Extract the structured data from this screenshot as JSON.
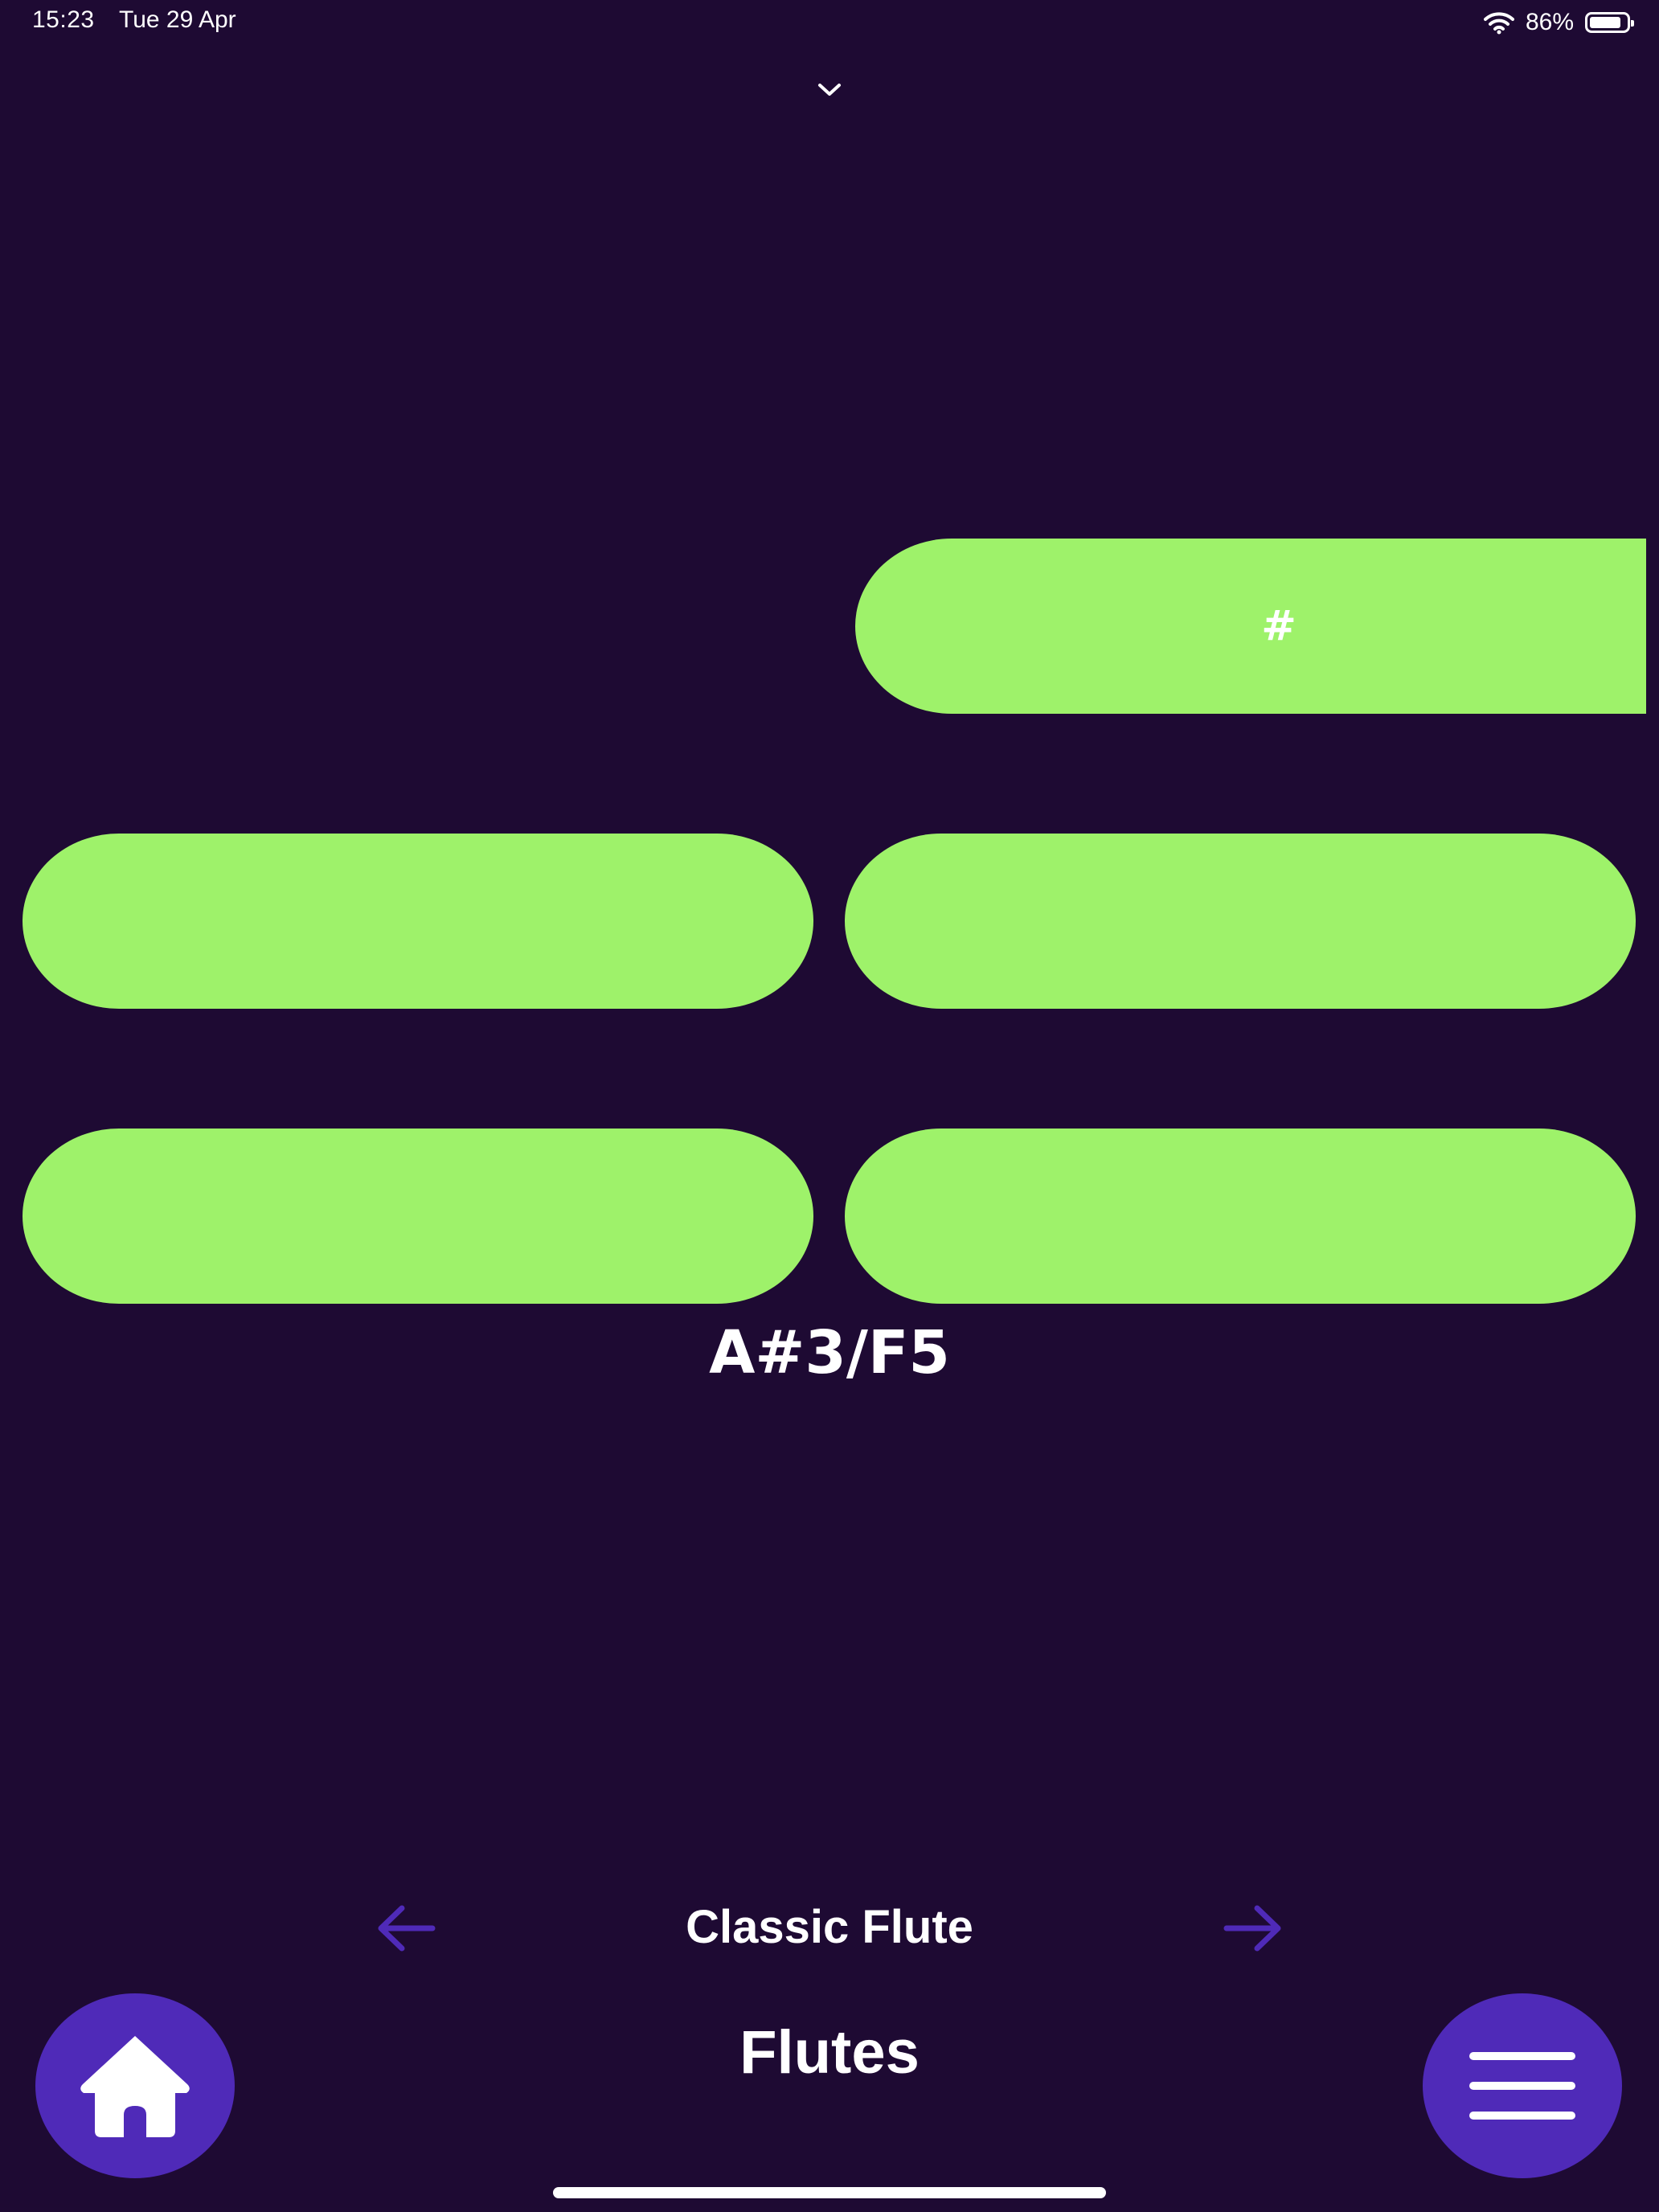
{
  "status_bar": {
    "time": "15:23",
    "date": "Tue 29 Apr",
    "battery_text": "86%",
    "battery_level": 0.86
  },
  "keys": {
    "sharp_label": "#",
    "key_color": "#9ef26a"
  },
  "note": "A#3/F5",
  "selector": {
    "instrument": "Classic Flute",
    "category": "Flutes"
  },
  "colors": {
    "background": "#1e0a33",
    "accent": "#4f2ab8",
    "key": "#9ef26a"
  },
  "icons": {
    "collapse": "chevron-down-icon",
    "prev": "arrow-left-icon",
    "next": "arrow-right-icon",
    "home": "home-icon",
    "menu": "hamburger-menu-icon",
    "wifi": "wifi-icon",
    "battery": "battery-icon"
  }
}
